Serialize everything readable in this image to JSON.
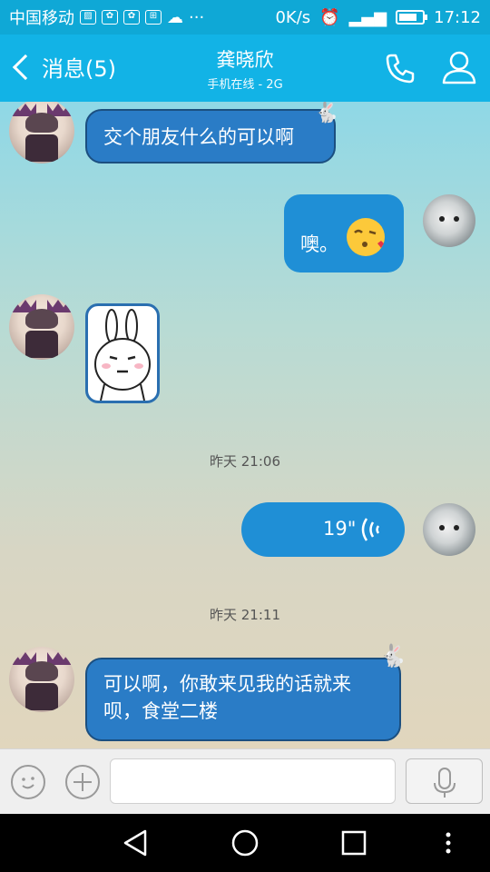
{
  "status_bar": {
    "carrier": "中国移动",
    "speed": "0K/s",
    "time": "17:12",
    "battery_level": 0.8,
    "icons": [
      "image-icon",
      "paw-icon",
      "paw-icon",
      "grid-icon",
      "cloud-icon",
      "more-icon",
      "alarm-icon",
      "signal-icon",
      "battery-icon"
    ]
  },
  "header": {
    "back_label": "消息(5)",
    "contact_name": "龚晓欣",
    "contact_status": "手机在线 - 2G",
    "icons": [
      "back-chevron-icon",
      "phone-icon",
      "profile-icon"
    ]
  },
  "messages": [
    {
      "side": "left",
      "type": "text",
      "text": "交个朋友什么的可以啊"
    },
    {
      "side": "right",
      "type": "text",
      "text": "噢。",
      "emoji": "kiss-face-icon"
    },
    {
      "side": "left",
      "type": "sticker",
      "sticker": "rabbit-sticker-icon"
    },
    {
      "type": "time",
      "text": "昨天 21:06"
    },
    {
      "side": "right",
      "type": "voice",
      "duration": "19\""
    },
    {
      "type": "time",
      "text": "昨天 21:11"
    },
    {
      "side": "left",
      "type": "text",
      "text": "可以啊，你敢来见我的话就来呗，食堂二楼"
    }
  ],
  "input_bar": {
    "input_value": "",
    "icons": [
      "emoji-icon",
      "plus-icon",
      "microphone-icon"
    ]
  },
  "nav_bar": {
    "icons": [
      "back-triangle-icon",
      "home-circle-icon",
      "recents-square-icon",
      "menu-dots-icon"
    ]
  },
  "colors": {
    "status_bar": "#0fa8d6",
    "title_bar": "#12b3e6",
    "bubble_blue": "#1f8fd6",
    "input_bar": "#efefef"
  }
}
